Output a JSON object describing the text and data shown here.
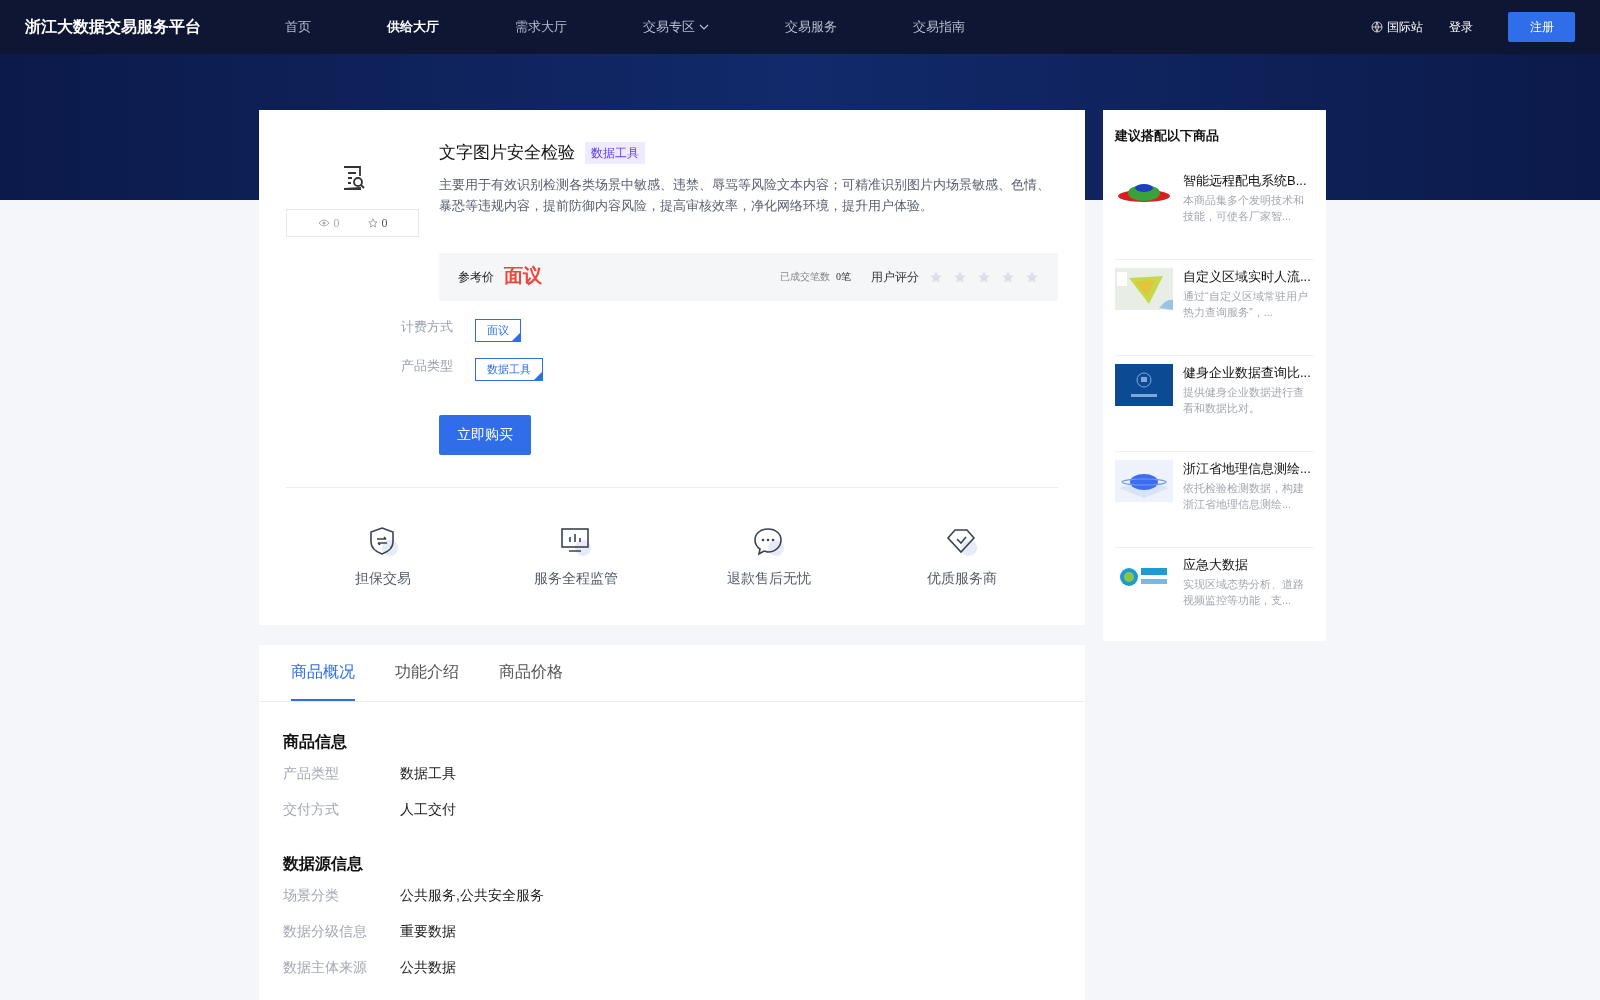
{
  "header": {
    "logo": "浙江大数据交易服务平台",
    "nav": [
      {
        "label": "首页",
        "selected": false,
        "dropdown": false
      },
      {
        "label": "供给大厅",
        "selected": true,
        "dropdown": false
      },
      {
        "label": "需求大厅",
        "selected": false,
        "dropdown": false
      },
      {
        "label": "交易专区",
        "selected": false,
        "dropdown": true
      },
      {
        "label": "交易服务",
        "selected": false,
        "dropdown": false
      },
      {
        "label": "交易指南",
        "selected": false,
        "dropdown": false
      }
    ],
    "site": "国际站",
    "login": "登录",
    "register": "注册"
  },
  "product": {
    "title": "文字图片安全检验",
    "tag": "数据工具",
    "description": "主要用于有效识别检测各类场景中敏感、违禁、辱骂等风险文本内容；可精准识别图片内场景敏感、色情、暴恐等违规内容，提前防御内容风险，提高审核效率，净化网络环境，提升用户体验。",
    "views": "0",
    "favorites": "0",
    "price_label": "参考价",
    "price": "面议",
    "deals_label": "已成交笔数",
    "deals": "0笔",
    "rating_label": "用户评分",
    "stars": 0,
    "options": [
      {
        "label": "计费方式",
        "value": "面议"
      },
      {
        "label": "产品类型",
        "value": "数据工具"
      }
    ],
    "buy": "立即购买",
    "guarantees": [
      {
        "kind": "shield",
        "label": "担保交易"
      },
      {
        "kind": "monitor",
        "label": "服务全程监管"
      },
      {
        "kind": "chat",
        "label": "退款售后无忧"
      },
      {
        "kind": "diamond",
        "label": "优质服务商"
      }
    ]
  },
  "tabs": [
    {
      "label": "商品概况",
      "selected": true
    },
    {
      "label": "功能介绍",
      "selected": false
    },
    {
      "label": "商品价格",
      "selected": false
    }
  ],
  "sections": [
    {
      "title": "商品信息",
      "rows": [
        {
          "label": "产品类型",
          "value": "数据工具"
        },
        {
          "label": "交付方式",
          "value": "人工交付"
        }
      ]
    },
    {
      "title": "数据源信息",
      "rows": [
        {
          "label": "场景分类",
          "value": "公共服务,公共安全服务"
        },
        {
          "label": "数据分级信息",
          "value": "重要数据"
        },
        {
          "label": "数据主体来源",
          "value": "公共数据"
        }
      ]
    }
  ],
  "recommend": {
    "title": "建议搭配以下商品",
    "items": [
      {
        "kind": "picture",
        "title": "智能远程配电系统B...",
        "desc": "本商品集多个发明技术和技能，可使各厂家智..."
      },
      {
        "kind": "picture",
        "title": "自定义区域实时人流...",
        "desc": "通过“自定义区域常驻用户热力查询服务”，..."
      },
      {
        "kind": "picture",
        "title": "健身企业数据查询比...",
        "desc": "提供健身企业数据进行查看和数据比对。"
      },
      {
        "kind": "picture",
        "title": "浙江省地理信息测绘...",
        "desc": "依托检验检测数据，构建浙江省地理信息测绘..."
      },
      {
        "kind": "picture",
        "title": "应急大数据",
        "desc": "实现区域态势分析、道路视频监控等功能，支..."
      }
    ]
  }
}
